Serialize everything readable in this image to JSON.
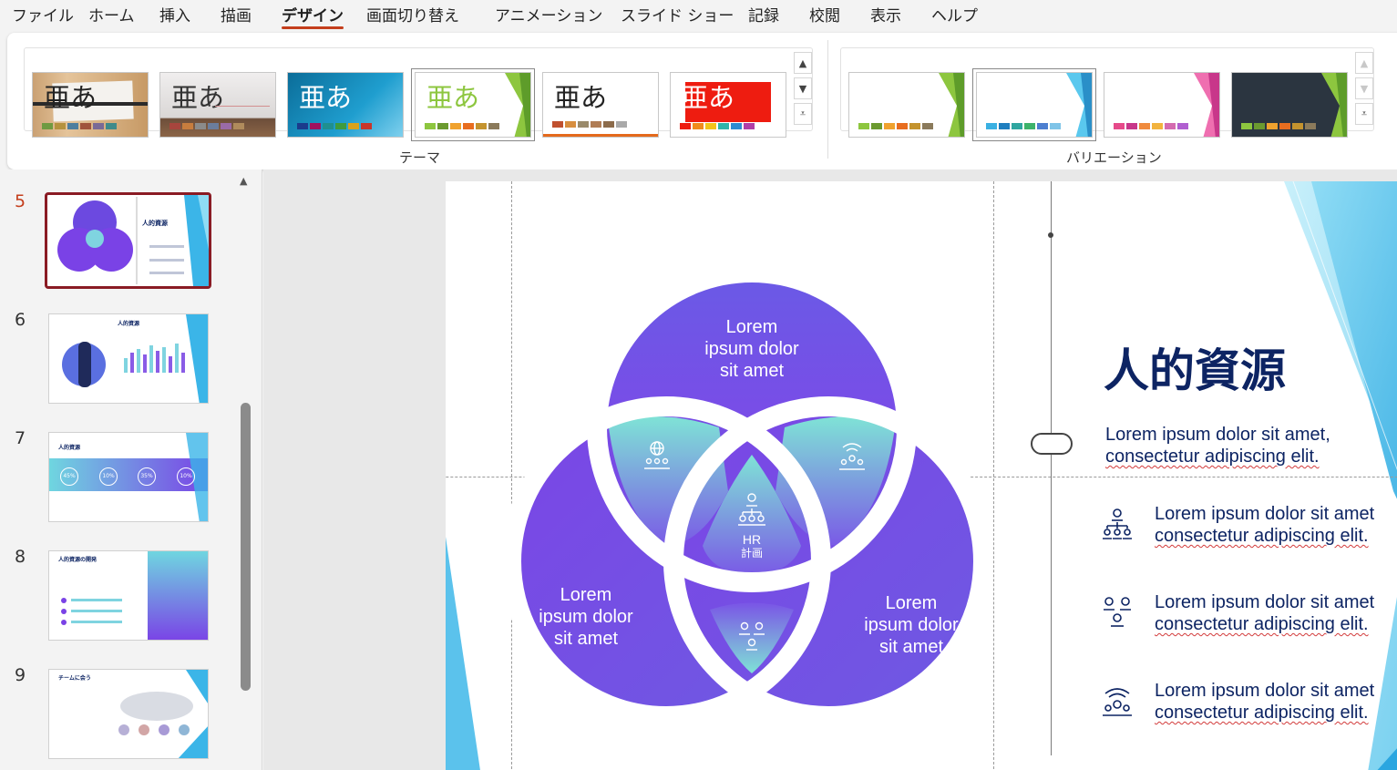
{
  "menu": {
    "items": [
      "ファイル",
      "ホーム",
      "挿入",
      "描画",
      "デザイン",
      "画面切り替え",
      "アニメーション",
      "スライド ショー",
      "記録",
      "校閲",
      "表示",
      "ヘルプ"
    ],
    "active": "デザイン"
  },
  "ribbon": {
    "themes_group_label": "テーマ",
    "variations_group_label": "バリエーション",
    "theme_sample_text": "亜あ",
    "colors": {
      "accent_red": "#c43e1c",
      "slide_title": "#0d2463",
      "venn_purple": "#7b3fe4",
      "venn_teal": "#7fe0d6"
    }
  },
  "slides_panel": {
    "slides": [
      {
        "number": "5",
        "title": "人的資源",
        "active": true
      },
      {
        "number": "6",
        "title": "人的資源",
        "active": false
      },
      {
        "number": "7",
        "title": "人的資源",
        "active": false
      },
      {
        "number": "8",
        "title": "人的資源の開発",
        "active": false
      },
      {
        "number": "9",
        "title": "チームに会う",
        "active": false
      }
    ],
    "thumb7_percents": [
      "45%",
      "10%",
      "35%",
      "10%"
    ]
  },
  "slide": {
    "title": "人的資源",
    "intro_line1": "Lorem ipsum dolor sit amet,",
    "intro_line2": "consectetur adipiscing elit.",
    "bullets": [
      {
        "line1": "Lorem ipsum dolor sit amet",
        "line2": "consectetur adipiscing elit.",
        "icon": "hierarchy-people-icon"
      },
      {
        "line1": "Lorem ipsum dolor sit amet",
        "line2": "consectetur adipiscing elit.",
        "icon": "team-people-icon"
      },
      {
        "line1": "Lorem ipsum dolor sit amet",
        "line2": "consectetur adipiscing elit.",
        "icon": "broadcast-people-icon"
      }
    ],
    "venn": {
      "top": [
        "Lorem",
        "ipsum dolor",
        "sit amet"
      ],
      "left": [
        "Lorem",
        "ipsum dolor",
        "sit amet"
      ],
      "right": [
        "Lorem",
        "ipsum dolor",
        "sit amet"
      ],
      "center": [
        "HR",
        "計画"
      ]
    }
  }
}
